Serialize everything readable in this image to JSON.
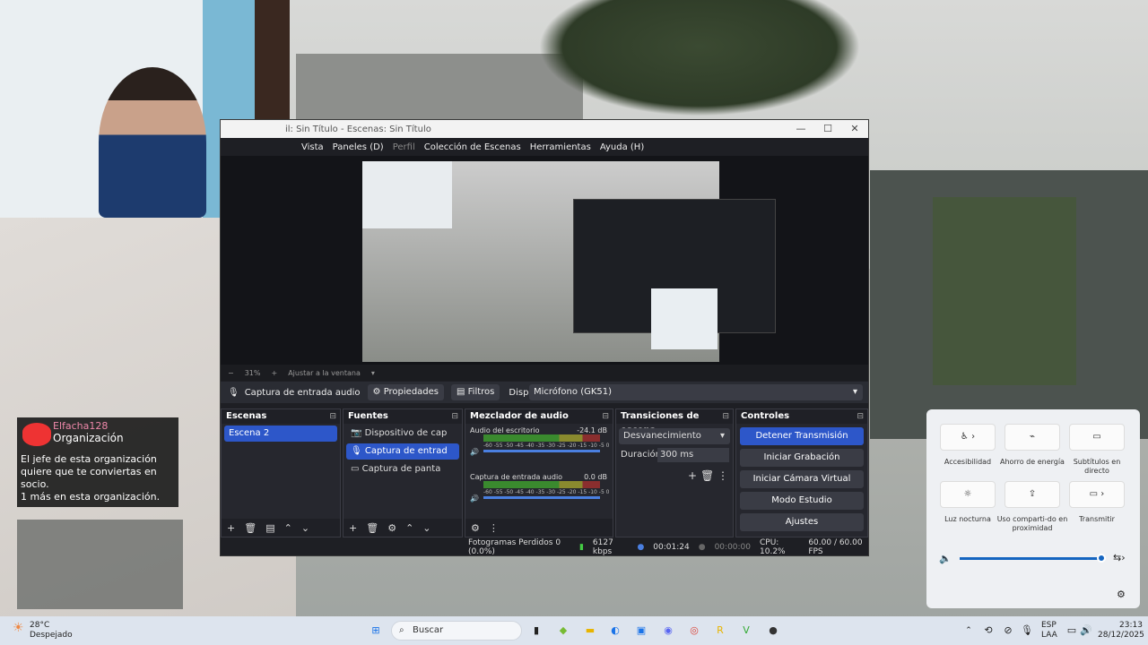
{
  "obs": {
    "title": "il: Sin Título - Escenas: Sin Título",
    "menu": [
      "Vista",
      "Paneles (D)",
      "Perfil",
      "Colección de Escenas",
      "Herramientas",
      "Ayuda (H)"
    ],
    "zoom": "31%",
    "fit": "Ajustar a la ventana",
    "source_name": "Captura de entrada audio",
    "props_btn": "Propiedades",
    "filters_btn": "Filtros",
    "device_label": "Dispositivo",
    "device_value": "Micrófono (GK51)",
    "scenes_title": "Escenas",
    "scenes": [
      "Escena 2"
    ],
    "sources_title": "Fuentes",
    "sources": [
      "Dispositivo de cap",
      "Captura de entrad",
      "Captura de panta"
    ],
    "mixer_title": "Mezclador de audio",
    "mixer": [
      {
        "name": "Audio del escritorio",
        "db": "-24.1 dB"
      },
      {
        "name": "Captura de entrada audio",
        "db": "0.0 dB"
      }
    ],
    "meter_scale": "-60 -55 -50 -45 -40 -35 -30 -25 -20 -15 -10 -5 0",
    "transitions_title": "Transiciones de escena",
    "transition": "Desvanecimiento",
    "duration_label": "Duración",
    "duration_value": "300 ms",
    "controls_title": "Controles",
    "controls": [
      "Detener Transmisión",
      "Iniciar Grabación",
      "Iniciar Cámara Virtual",
      "Modo Estudio",
      "Ajustes"
    ],
    "status": {
      "dropped": "Fotogramas Perdidos 0 (0.0%)",
      "bitrate": "6127 kbps",
      "live_time": "00:01:24",
      "rec_time": "00:00:00",
      "cpu": "CPU: 10.2%",
      "fps": "60.00 / 60.00 FPS"
    }
  },
  "notification": {
    "user": "Elfacha128",
    "title": "Organización",
    "body": "El jefe de esta organización quiere que te conviertas en socio.\n1 más en esta organización."
  },
  "quick_settings": {
    "tiles": [
      {
        "label": "Accesibilidad",
        "icon": "accessibility-icon"
      },
      {
        "label": "Ahorro de energía",
        "icon": "battery-saver-icon"
      },
      {
        "label": "Subtítulos en directo",
        "icon": "captions-icon"
      },
      {
        "label": "Luz nocturna",
        "icon": "night-light-icon"
      },
      {
        "label": "Uso comparti-do en proximidad",
        "icon": "nearby-share-icon"
      },
      {
        "label": "Transmitir",
        "icon": "cast-icon"
      }
    ],
    "volume_percent": 100
  },
  "taskbar": {
    "weather_temp": "28°C",
    "weather_desc": "Despejado",
    "search_placeholder": "Buscar",
    "lang": "ESP",
    "lang2": "LAA",
    "time": "23:13",
    "date": "28/12/2025"
  }
}
